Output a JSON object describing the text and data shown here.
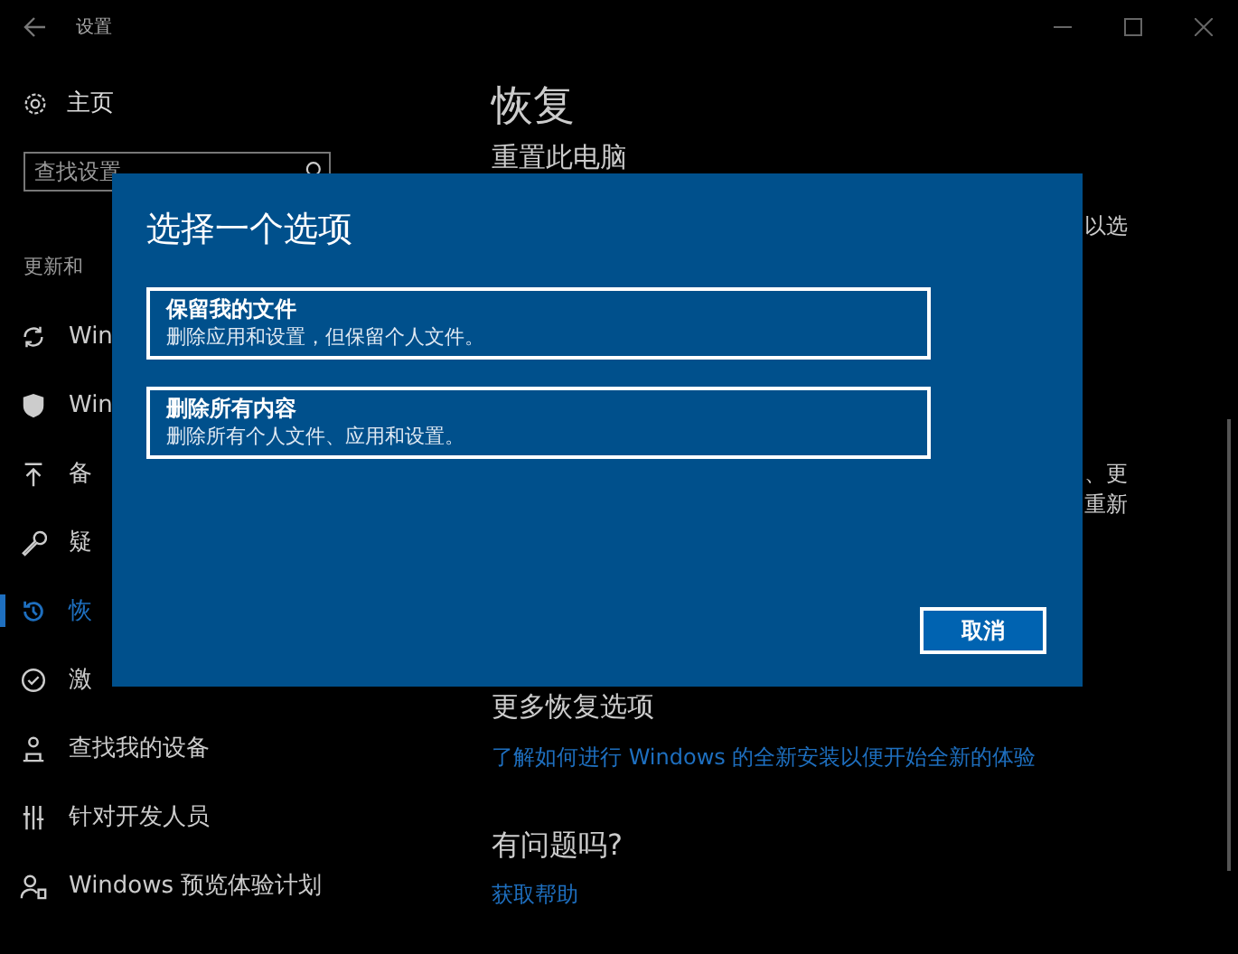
{
  "window": {
    "title": "设置"
  },
  "sidebar": {
    "home": "主页",
    "search": {
      "placeholder": "查找设置"
    },
    "section": "更新和",
    "items": [
      {
        "label": "Win",
        "selected": false
      },
      {
        "label": "Win",
        "selected": false
      },
      {
        "label": "备",
        "selected": false
      },
      {
        "label": "疑",
        "selected": false
      },
      {
        "label": "恢",
        "selected": true
      },
      {
        "label": "激",
        "selected": false
      },
      {
        "label": "查找我的设备",
        "selected": false
      },
      {
        "label": "针对开发人员",
        "selected": false
      },
      {
        "label": "Windows 预览体验计划",
        "selected": false
      }
    ]
  },
  "content": {
    "title": "恢复",
    "reset_heading": "重置此电脑",
    "fragments": [
      "以选",
      "、更",
      "重新"
    ],
    "more_heading": "更多恢复选项",
    "more_link": "了解如何进行 Windows 的全新安装以便开始全新的体验",
    "help_heading": "有问题吗?",
    "help_link": "获取帮助"
  },
  "dialog": {
    "title": "选择一个选项",
    "options": [
      {
        "title": "保留我的文件",
        "description": "删除应用和设置，但保留个人文件。"
      },
      {
        "title": "删除所有内容",
        "description": "删除所有个人文件、应用和设置。"
      }
    ],
    "cancel": "取消"
  }
}
